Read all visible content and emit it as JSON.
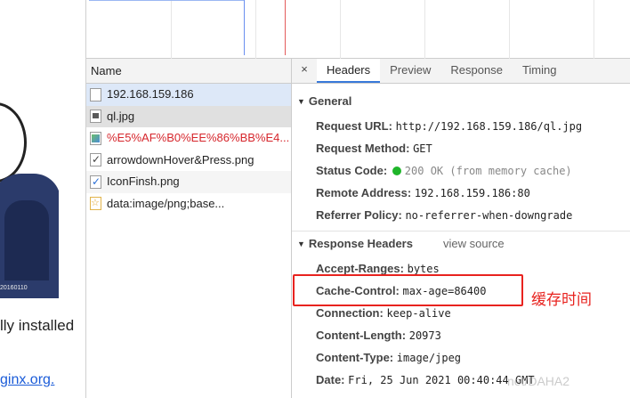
{
  "page": {
    "image_stamp": "20160110",
    "text_fragment": "lly installed",
    "link_fragment": "ginx.org."
  },
  "requests": {
    "column_header": "Name",
    "items": [
      {
        "label": "192.168.159.186",
        "icon": "document-icon"
      },
      {
        "label": "ql.jpg",
        "icon": "image-file-icon"
      },
      {
        "label": "%E5%AF%B0%EE%86%BB%E4...",
        "icon": "picture-icon"
      },
      {
        "label": "arrowdownHover&Press.png",
        "icon": "check-icon"
      },
      {
        "label": "IconFinsh.png",
        "icon": "check-blue-icon"
      },
      {
        "label": "data:image/png;base...",
        "icon": "star-icon"
      }
    ]
  },
  "tabs": {
    "close": "×",
    "items": [
      "Headers",
      "Preview",
      "Response",
      "Timing"
    ],
    "active": "Headers"
  },
  "general": {
    "title": "General",
    "rows": [
      {
        "key": "Request URL:",
        "value": "http://192.168.159.186/ql.jpg"
      },
      {
        "key": "Request Method:",
        "value": "GET"
      },
      {
        "key": "Status Code:",
        "value": "200 OK (from memory cache)"
      },
      {
        "key": "Remote Address:",
        "value": "192.168.159.186:80"
      },
      {
        "key": "Referrer Policy:",
        "value": "no-referrer-when-downgrade"
      }
    ]
  },
  "response_headers": {
    "title": "Response Headers",
    "view_source": "view source",
    "rows": [
      {
        "key": "Accept-Ranges:",
        "value": "bytes"
      },
      {
        "key": "Cache-Control:",
        "value": "max-age=86400"
      },
      {
        "key": "Connection:",
        "value": "keep-alive"
      },
      {
        "key": "Content-Length:",
        "value": "20973"
      },
      {
        "key": "Content-Type:",
        "value": "image/jpeg"
      },
      {
        "key": "Date:",
        "value": "Fri, 25 Jun 2021 00:40:44 GMT"
      }
    ]
  },
  "annotation": "缓存时间",
  "watermark": "net/DAHA2",
  "colors": {
    "accent": "#3879d9",
    "annotation": "#e8231f",
    "status_ok": "#1fb52a"
  }
}
